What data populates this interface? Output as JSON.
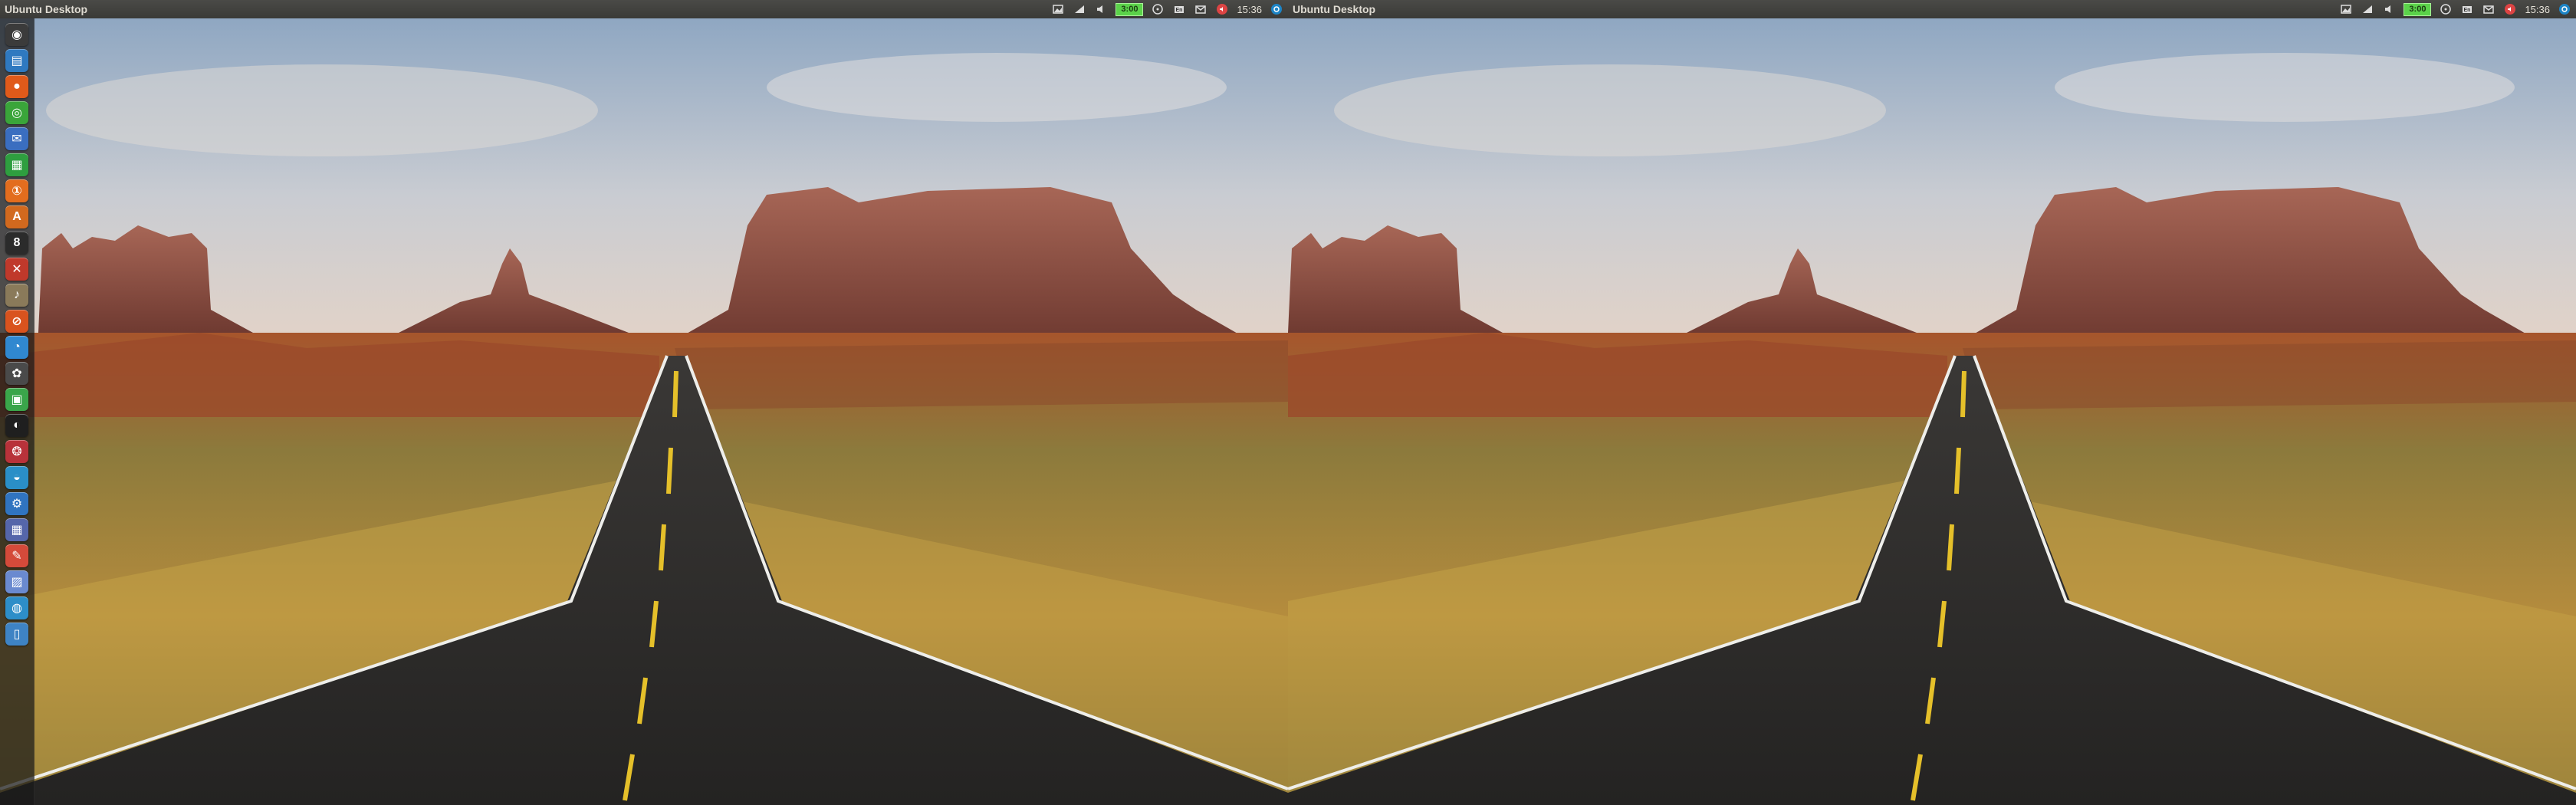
{
  "screens": [
    {
      "panel": {
        "title": "Ubuntu Desktop",
        "battery_label": "3:00",
        "time": "15:36",
        "indicators": [
          "image-icon",
          "network-icon",
          "sound-icon",
          "battery-icon",
          "disc-icon",
          "keyboard-icon",
          "mail-icon",
          "volume-icon",
          "settings-icon"
        ]
      },
      "launcher": {
        "items": [
          {
            "icon": "dash-icon",
            "color": "#3b3b3b",
            "glyph": "◉"
          },
          {
            "icon": "files-icon",
            "color": "#2f79c0",
            "glyph": "▤"
          },
          {
            "icon": "firefox-icon",
            "color": "#e05a1a",
            "glyph": "●"
          },
          {
            "icon": "chrome-icon",
            "color": "#3aa53a",
            "glyph": "◎"
          },
          {
            "icon": "thunderbird-icon",
            "color": "#3a6ec0",
            "glyph": "✉"
          },
          {
            "icon": "spreadsheet-icon",
            "color": "#2e9e3f",
            "glyph": "▦"
          },
          {
            "icon": "ubuntu-one-icon",
            "color": "#e36d1e",
            "glyph": "①"
          },
          {
            "icon": "software-center-icon",
            "color": "#d2691e",
            "glyph": "A"
          },
          {
            "icon": "terminal-icon",
            "color": "#2b2b2b",
            "glyph": "8"
          },
          {
            "icon": "tools-icon",
            "color": "#c0392b",
            "glyph": "✕"
          },
          {
            "icon": "audio-icon",
            "color": "#8a7a5a",
            "glyph": "♪"
          },
          {
            "icon": "help-icon",
            "color": "#d9531e",
            "glyph": "⊘"
          },
          {
            "icon": "chat-icon",
            "color": "#3088d0",
            "glyph": "◔"
          },
          {
            "icon": "media-icon",
            "color": "#4a4a4a",
            "glyph": "✿"
          },
          {
            "icon": "calculator-icon",
            "color": "#3aa54a",
            "glyph": "▣"
          },
          {
            "icon": "system-icon",
            "color": "#1f1f1f",
            "glyph": "◐"
          },
          {
            "icon": "gimp-icon",
            "color": "#b8323a",
            "glyph": "❂"
          },
          {
            "icon": "browser-icon",
            "color": "#2a8fc7",
            "glyph": "◒"
          },
          {
            "icon": "settings-icon",
            "color": "#3074c0",
            "glyph": "⚙"
          },
          {
            "icon": "workspace-icon",
            "color": "#5566aa",
            "glyph": "▦"
          },
          {
            "icon": "editor-icon",
            "color": "#d44a3a",
            "glyph": "✎"
          },
          {
            "icon": "photo-icon",
            "color": "#6a8ad0",
            "glyph": "▨"
          },
          {
            "icon": "web-icon",
            "color": "#2d8ec8",
            "glyph": "◍"
          },
          {
            "icon": "trash-icon",
            "color": "#3e83c4",
            "glyph": "▯"
          }
        ]
      }
    },
    {
      "panel": {
        "title": "Ubuntu Desktop",
        "battery_label": "3:00",
        "time": "15:36",
        "indicators": [
          "image-icon",
          "network-icon",
          "sound-icon",
          "battery-icon",
          "disc-icon",
          "keyboard-icon",
          "mail-icon",
          "volume-icon",
          "settings-icon"
        ]
      }
    }
  ]
}
